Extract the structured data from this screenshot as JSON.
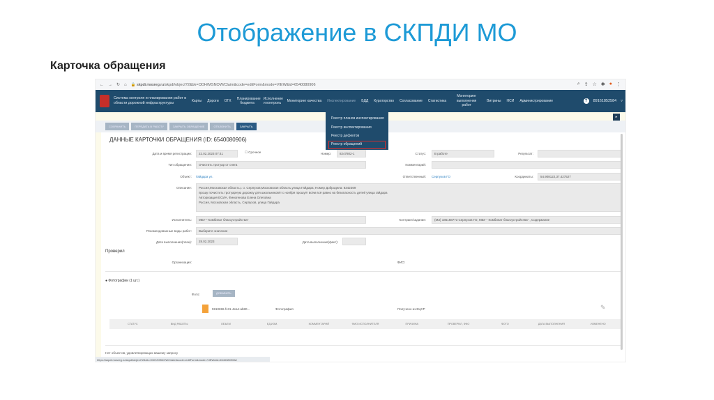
{
  "slide": {
    "title": "Отображение в СКПДИ МО",
    "subtitle": "Карточка обращения"
  },
  "browser": {
    "url_host": "skpdi.mosreg.ru",
    "url_path": "/skpdi/object?2&bk=ODH/MSNOW/Claim&code=editForm&mode=VIEW&id=6540080906",
    "status_url": "https://skpdi.mosreg.ru/skpdi/object?2&bk=ODH/MSNOW/Claim&code=editForm&mode=VIEW&id=6540080906#"
  },
  "header": {
    "system_name": "Система контроля и планирования работ в области дорожной инфраструктуры",
    "nav": [
      "Карты",
      "Дороги",
      "ОГХ",
      "Планирование бюджета",
      "Исполнение и контроль",
      "Мониторинг качества",
      "Инспектирование",
      "БДД",
      "Кураторство",
      "Согласование",
      "Статистика",
      "Мониторинг выполнения работ",
      "Витрины",
      "НСИ",
      "Администрирование"
    ],
    "user": "89161852584"
  },
  "menu": [
    "Реестр планов инспектирования",
    "Реестр инспектирования",
    "Реестр дефектов",
    "Реестр обращений"
  ],
  "toolbar": [
    "СОХРАНИТЬ",
    "ПЕРЕДАТЬ В РАБОТУ",
    "ЗАКРЫТЬ ОБРАЩЕНИЕ",
    "ОТКЛОНИТЬ",
    "ЗАКРЫТЬ"
  ],
  "card": {
    "title": "ДАННЫЕ КАРТОЧКИ ОБРАЩЕНИЯ (ID: 6540080906)",
    "reg_label": "Дата и время регистрации:",
    "reg_value": "22.02.2023 07:41",
    "urgent_label": "Срочное",
    "number_label": "Номер:",
    "number_value": "8247802-1",
    "status_label": "Статус:",
    "status_value": "В работе",
    "result_label": "Результат:",
    "type_label": "Тип обращения:",
    "type_value": "Очистить тротуар от снега",
    "comment_label": "Комментарий:",
    "object_label": "Объект:",
    "object_value": "Гайдара ул.",
    "resp_label": "Ответственный:",
    "resp_value": "Серпухов ГО",
    "coord_label": "Координаты:",
    "coord_value": "54.908122,37.427527",
    "desc_label": "Описание:",
    "desc_lines": [
      "Россия,Московская область,г. о. Серпухов,Московская область,улица Гайдара; Номер Добродела: 8342369",
      "прошу почистить тротуарную дорожку для школьников!!! с ноября прошу!!! всём всё равно на безопасность детей улица гайдара",
      "Авторизация ЕСИА, Финогенова Елена Олеговна",
      "Россия, Московская область, Серпухов, улица Гайдара"
    ],
    "executor_label": "Исполнитель:",
    "executor_value": "МБУ \" Комбинат благоустройства\"",
    "contract_label": "Контракт/задание:",
    "contract_value": "(МЗ) 185168773 Серпухов ГО, МБУ \" Комбинат благоустройства\" , Содержание",
    "works_label": "Рекомендованные виды работ:",
    "works_value": "Выберите значение",
    "plan_label": "Дата выполнения(план):",
    "plan_value": "28.02.2023",
    "fact_label": "Дата выполнения(факт):",
    "checked": "Проверил",
    "org_label": "Организация:",
    "fio_label": "ФИО:",
    "photos": "Фотографии  (1 шт.)",
    "photo_label": "Фото:",
    "add_btn": "ДОБАВИТЬ",
    "file_name": "5910696-fc31-4ea4-ab80...",
    "file_type": "Фотография",
    "file_source": "Получено из ЕЦУР",
    "columns": [
      "СТАТУС",
      "ВИД РАБОТЫ",
      "ОБЪЕМ",
      "ЕД.ИЗМ.",
      "КОММЕНТАРИЙ",
      "ФИО ИСПОЛНИТЕЛЯ",
      "ПРИЧИНА",
      "ПРОВЕРИЛ, ФИО",
      "ФОТО",
      "ДАТА ВЫПОЛНЕНИЯ",
      "ИЗМЕНЕНО"
    ],
    "empty": "Нет объектов, удовлетворяющих вашему запросу"
  }
}
